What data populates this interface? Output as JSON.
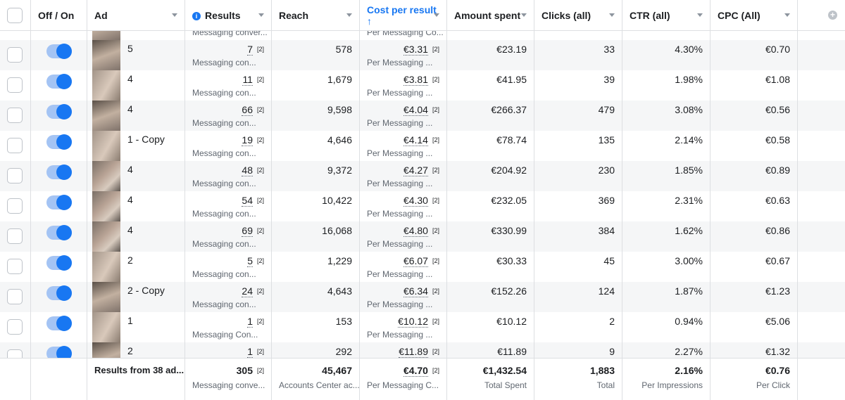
{
  "columns": {
    "toggle": "Off / On",
    "ad": "Ad",
    "results": "Results",
    "reach": "Reach",
    "cost_per_result": "Cost per result",
    "amount_spent": "Amount spent",
    "clicks": "Clicks (all)",
    "ctr": "CTR (all)",
    "cpc": "CPC (All)"
  },
  "annotation": "[2]",
  "partial_row": {
    "results_sub": "Messaging conver...",
    "cost_sub": "Per Messaging Co..."
  },
  "rows": [
    {
      "ad": "5",
      "results": "7",
      "results_sub": "Messaging con...",
      "reach": "578",
      "cost": "€3.31",
      "cost_sub": "Per Messaging ...",
      "spent": "€23.19",
      "clicks": "33",
      "ctr": "4.30%",
      "cpc": "€0.70"
    },
    {
      "ad": "4",
      "results": "11",
      "results_sub": "Messaging con...",
      "reach": "1,679",
      "cost": "€3.81",
      "cost_sub": "Per Messaging ...",
      "spent": "€41.95",
      "clicks": "39",
      "ctr": "1.98%",
      "cpc": "€1.08"
    },
    {
      "ad": "4",
      "results": "66",
      "results_sub": "Messaging con...",
      "reach": "9,598",
      "cost": "€4.04",
      "cost_sub": "Per Messaging ...",
      "spent": "€266.37",
      "clicks": "479",
      "ctr": "3.08%",
      "cpc": "€0.56"
    },
    {
      "ad": "1 - Copy",
      "results": "19",
      "results_sub": "Messaging con...",
      "reach": "4,646",
      "cost": "€4.14",
      "cost_sub": "Per Messaging ...",
      "spent": "€78.74",
      "clicks": "135",
      "ctr": "2.14%",
      "cpc": "€0.58"
    },
    {
      "ad": "4",
      "results": "48",
      "results_sub": "Messaging con...",
      "reach": "9,372",
      "cost": "€4.27",
      "cost_sub": "Per Messaging ...",
      "spent": "€204.92",
      "clicks": "230",
      "ctr": "1.85%",
      "cpc": "€0.89"
    },
    {
      "ad": "4",
      "results": "54",
      "results_sub": "Messaging con...",
      "reach": "10,422",
      "cost": "€4.30",
      "cost_sub": "Per Messaging ...",
      "spent": "€232.05",
      "clicks": "369",
      "ctr": "2.31%",
      "cpc": "€0.63"
    },
    {
      "ad": "4",
      "results": "69",
      "results_sub": "Messaging con...",
      "reach": "16,068",
      "cost": "€4.80",
      "cost_sub": "Per Messaging ...",
      "spent": "€330.99",
      "clicks": "384",
      "ctr": "1.62%",
      "cpc": "€0.86"
    },
    {
      "ad": "2",
      "results": "5",
      "results_sub": "Messaging con...",
      "reach": "1,229",
      "cost": "€6.07",
      "cost_sub": "Per Messaging ...",
      "spent": "€30.33",
      "clicks": "45",
      "ctr": "3.00%",
      "cpc": "€0.67"
    },
    {
      "ad": "2 - Copy",
      "results": "24",
      "results_sub": "Messaging con...",
      "reach": "4,643",
      "cost": "€6.34",
      "cost_sub": "Per Messaging ...",
      "spent": "€152.26",
      "clicks": "124",
      "ctr": "1.87%",
      "cpc": "€1.23"
    },
    {
      "ad": "1",
      "results": "1",
      "results_sub": "Messaging Con...",
      "reach": "153",
      "cost": "€10.12",
      "cost_sub": "Per Messaging ...",
      "spent": "€10.12",
      "clicks": "2",
      "ctr": "0.94%",
      "cpc": "€5.06"
    },
    {
      "ad": "2",
      "results": "1",
      "results_sub": "",
      "reach": "292",
      "cost": "€11.89",
      "cost_sub": "",
      "spent": "€11.89",
      "clicks": "9",
      "ctr": "2.27%",
      "cpc": "€1.32"
    }
  ],
  "footer": {
    "label": "Results from 38 ad...",
    "results": "305",
    "results_sub": "Messaging conve...",
    "reach": "45,467",
    "reach_sub": "Accounts Center ac...",
    "cost": "€4.70",
    "cost_sub": "Per Messaging C...",
    "spent": "€1,432.54",
    "spent_sub": "Total Spent",
    "clicks": "1,883",
    "clicks_sub": "Total",
    "ctr": "2.16%",
    "ctr_sub": "Per Impressions",
    "cpc": "€0.76",
    "cpc_sub": "Per Click"
  },
  "icons": {
    "results_info": "info-icon",
    "sort": "arrow-up-icon",
    "add_column": "plus-circle-icon"
  },
  "colors": {
    "accent": "#1877f2",
    "toggle_track": "#a4c4f4",
    "row_alt": "#f5f6f7"
  }
}
